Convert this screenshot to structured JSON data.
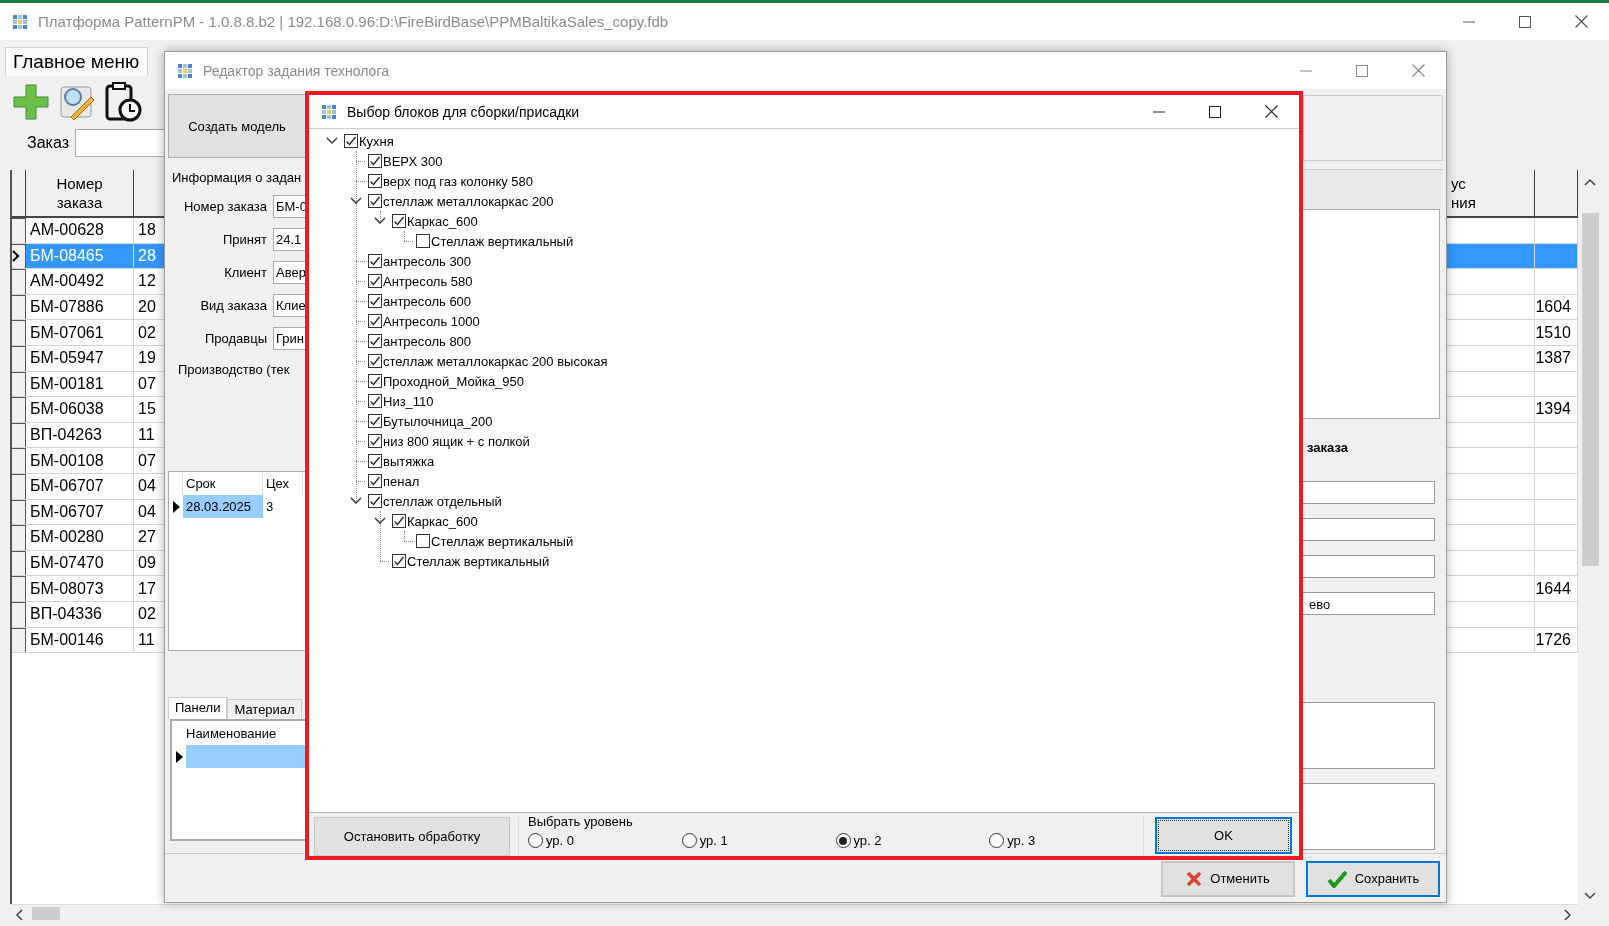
{
  "main_window": {
    "title": "Платформа PatternPM - 1.0.8.8.b2 | 192.168.0.96:D:\\FireBirdBase\\PPMBaltikaSales_copy.fdb",
    "tabs": [
      {
        "label": "Главное меню",
        "selected": true
      }
    ],
    "order_search": {
      "label": "Заказ"
    },
    "orders_table": {
      "columns": [
        "Номер\nзаказа",
        "ус\nния"
      ],
      "rows": [
        {
          "order_number": "АМ-00628",
          "column_2": "18",
          "selected": false
        },
        {
          "order_number": "БМ-08465",
          "column_2": "28",
          "selected": true
        },
        {
          "order_number": "АМ-00492",
          "column_2": "12",
          "selected": false
        },
        {
          "order_number": "БМ-07886",
          "column_2": "20",
          "column_4": "1604",
          "selected": false
        },
        {
          "order_number": "БМ-07061",
          "column_2": "02",
          "column_4": "1510",
          "selected": false
        },
        {
          "order_number": "БМ-05947",
          "column_2": "19",
          "column_4": "1387",
          "selected": false
        },
        {
          "order_number": "БМ-00181",
          "column_2": "07",
          "selected": false
        },
        {
          "order_number": "БМ-06038",
          "column_2": "15",
          "column_4": "1394",
          "selected": false
        },
        {
          "order_number": "ВП-04263",
          "column_2": "11",
          "selected": false
        },
        {
          "order_number": "БМ-00108",
          "column_2": "07",
          "selected": false
        },
        {
          "order_number": "БМ-06707",
          "column_2": "04",
          "selected": false
        },
        {
          "order_number": "БМ-06707",
          "column_2": "04",
          "selected": false
        },
        {
          "order_number": "БМ-00280",
          "column_2": "27",
          "selected": false
        },
        {
          "order_number": "БМ-07470",
          "column_2": "09",
          "selected": false
        },
        {
          "order_number": "БМ-08073",
          "column_2": "17",
          "column_4": "1644",
          "selected": false
        },
        {
          "order_number": "ВП-04336",
          "column_2": "02",
          "selected": false
        },
        {
          "order_number": "БМ-00146",
          "column_2": "11",
          "column_4": "1726",
          "selected": false
        }
      ]
    }
  },
  "editor_window": {
    "title": "Редактор задания технолога",
    "create_model_button": "Создать модель",
    "info_group": {
      "title": "Информация о задан",
      "fields": [
        {
          "label": "Номер заказа",
          "value": "БМ-0"
        },
        {
          "label": "Принят",
          "value": "24.1"
        },
        {
          "label": "Клиент",
          "value": "Авер"
        },
        {
          "label": "Вид заказа",
          "value": "Клие"
        },
        {
          "label": "Продавцы",
          "value": "Грин"
        }
      ],
      "production_label": "Производство (тек"
    },
    "terms_table": {
      "columns": [
        "Срок",
        "Цех"
      ],
      "rows": [
        {
          "cells": [
            "28.03.2025",
            "3"
          ],
          "selected": true
        }
      ]
    },
    "tabs": [
      {
        "label": "Панели",
        "selected": true
      },
      {
        "label": "Материал",
        "selected": false
      }
    ],
    "panels_table": {
      "columns": [
        "Наименование"
      ],
      "rows": [
        {
          "selected": true
        }
      ]
    },
    "order_group": {
      "title": "заказа",
      "fields": [
        {
          "value": "ево"
        }
      ]
    },
    "buttons": [
      {
        "label": "Отменить",
        "kind": "cancel",
        "focused": false
      },
      {
        "label": "Сохранить",
        "kind": "save",
        "focused": true
      }
    ]
  },
  "dialog": {
    "title": "Выбор блоков для сборки/присадки",
    "highlighted": true,
    "tree": [
      {
        "label": "Кухня",
        "checked": true,
        "expanded": true,
        "children": [
          {
            "label": "ВЕРХ 300",
            "checked": true
          },
          {
            "label": "верх под газ колонку 580",
            "checked": true
          },
          {
            "label": "стеллаж металлокаркас 200",
            "checked": true,
            "expanded": true,
            "children": [
              {
                "label": "Каркас_600",
                "checked": true,
                "expanded": true,
                "children": [
                  {
                    "label": "Стеллаж вертикальный",
                    "checked": false
                  }
                ]
              }
            ]
          },
          {
            "label": "антресоль 300",
            "checked": true
          },
          {
            "label": "Антресоль 580",
            "checked": true
          },
          {
            "label": "антресоль 600",
            "checked": true
          },
          {
            "label": "Антресоль 1000",
            "checked": true
          },
          {
            "label": "антресоль 800",
            "checked": true
          },
          {
            "label": "стеллаж металлокаркас 200 высокая",
            "checked": true
          },
          {
            "label": "Проходной_Мойка_950",
            "checked": true
          },
          {
            "label": "Низ_110",
            "checked": true
          },
          {
            "label": "Бутылочница_200",
            "checked": true
          },
          {
            "label": "низ 800 ящик + с полкой",
            "checked": true
          },
          {
            "label": "вытяжка",
            "checked": true
          },
          {
            "label": "пенал",
            "checked": true
          },
          {
            "label": "стеллаж отдельный",
            "checked": true,
            "expanded": true,
            "children": [
              {
                "label": "Каркас_600",
                "checked": true,
                "expanded": true,
                "children": [
                  {
                    "label": "Стеллаж вертикальный",
                    "checked": false
                  }
                ]
              },
              {
                "label": "Стеллаж вертикальный",
                "checked": true
              }
            ]
          }
        ]
      }
    ],
    "stop_button": "Остановить обработку",
    "level_group": {
      "title": "Выбрать уровень",
      "options": [
        {
          "label": "ур. 0",
          "selected": false
        },
        {
          "label": "ур. 1",
          "selected": false
        },
        {
          "label": "ур. 2",
          "selected": true
        },
        {
          "label": "ур. 3",
          "selected": false
        }
      ]
    },
    "ok_button": {
      "label": "OK",
      "focused": true
    }
  }
}
